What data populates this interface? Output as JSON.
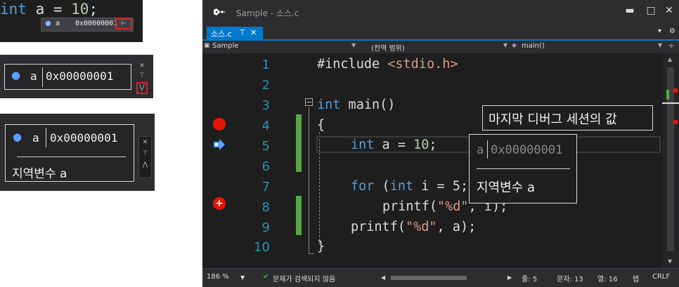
{
  "left_panels": {
    "snippet": {
      "code_kw": "int",
      "code_mid": " a = ",
      "code_num": "10",
      "code_end": ";",
      "tip_name": "a",
      "tip_value": "0x00000001"
    },
    "datatip_collapsed": {
      "name": "a",
      "value": "0x00000001"
    },
    "datatip_expanded": {
      "name": "a",
      "value": "0x00000001",
      "comment": "지역변수 a"
    }
  },
  "window": {
    "title": "Sample - 소스.c",
    "tab_label": "소스.c",
    "nav_project": "Sample",
    "nav_scope": "(전역 범위)",
    "nav_function": "main()"
  },
  "editor": {
    "line_numbers": [
      "1",
      "2",
      "3",
      "4",
      "5",
      "6",
      "7",
      "8",
      "9",
      "10"
    ],
    "lines": {
      "l1_a": "#include ",
      "l1_b": "<stdio.h>",
      "l3_kw": "int",
      "l3_rest": " main()",
      "l4": "{",
      "l5_kw": "int",
      "l5_mid": " a = ",
      "l5_num": "10",
      "l5_end": ";",
      "l7_kw": "for",
      "l7_mid": " (",
      "l7_kw2": "int",
      "l7_rest": " i = 5;",
      "l8_a": "printf(",
      "l8_str": "\"%d\"",
      "l8_b": ", i);",
      "l9_a": "printf(",
      "l9_str": "\"%d\"",
      "l9_b": ", a);",
      "l10": "}"
    }
  },
  "last_session_banner": "마지막 디버그 세션의 값",
  "datatip": {
    "name": "a",
    "value": "0x00000001",
    "comment": "지역변수 a"
  },
  "status": {
    "zoom": "186 %",
    "issues": "문제가 검색되지 않음",
    "line": "줄: 5",
    "char": "문자: 13",
    "col": "열: 16",
    "indent": "탭",
    "eol": "CRLF"
  },
  "colors": {
    "accent": "#007acc",
    "breakpoint": "#e51400",
    "change_bar": "#57a64a"
  }
}
